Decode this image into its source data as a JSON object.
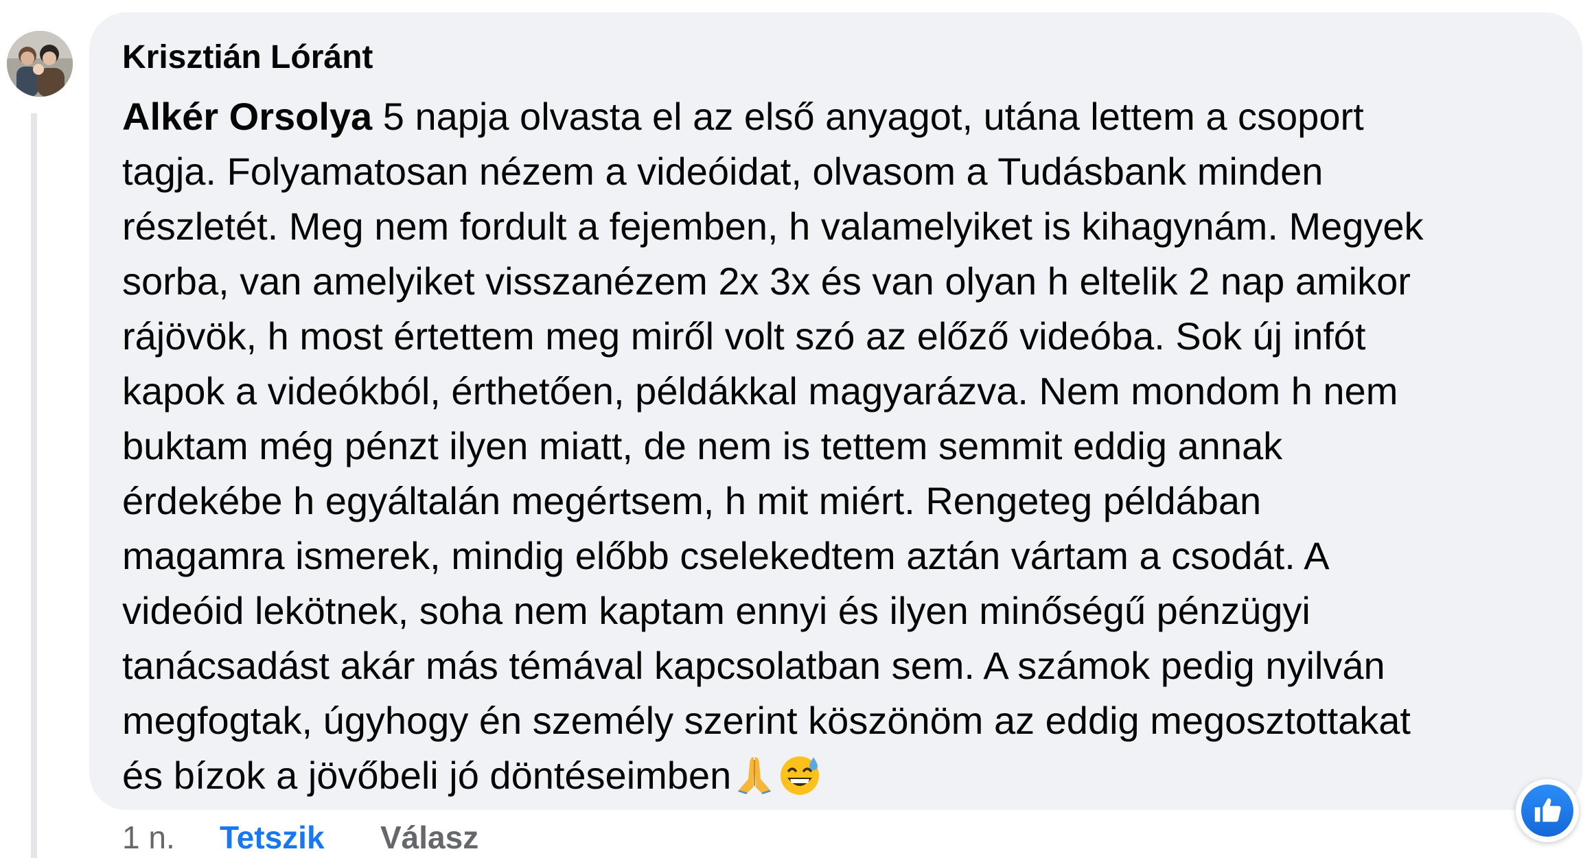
{
  "comment": {
    "author_name": "Krisztián Lóránt",
    "mention": "Alkér Orsolya",
    "lines": [
      " 5 napja olvasta el az első anyagot, utána lettem a csoport",
      "tagja. Folyamatosan nézem a videóidat, olvasom a Tudásbank minden",
      "részletét. Meg nem fordult a fejemben, h valamelyiket is kihagynám. Megyek",
      "sorba, van amelyiket visszanézem 2x 3x és van olyan h eltelik 2 nap amikor",
      "rájövök, h most értettem meg miről volt szó az előző videóba. Sok új infót",
      "kapok a videókból, érthetően, példákkal magyarázva. Nem mondom h nem",
      "buktam még pénzt ilyen miatt, de nem is tettem semmit eddig annak",
      "érdekébe h egyáltalán megértsem, h mit miért. Rengeteg példában",
      "magamra ismerek, mindig előbb cselekedtem aztán vártam a csodát. A",
      "videóid lekötnek, soha nem kaptam ennyi és ilyen minőségű pénzügyi",
      "tanácsadást akár más témával kapcsolatban sem. A számok pedig nyilván",
      "megfogtak, úgyhogy én személy szerint köszönöm az eddig megosztottakat",
      "és bízok a jövőbeli jó döntéseimben"
    ],
    "emojis": [
      "folded-hands-emoji",
      "grinning-sweat-emoji"
    ],
    "reaction_icon": "thumbs-up-icon"
  },
  "actions": {
    "timestamp": "1 n.",
    "like_label": "Tetszik",
    "reply_label": "Válasz"
  },
  "colors": {
    "bubble_background": "#f0f2f5",
    "text": "#050505",
    "secondary_text": "#65676b",
    "accent_blue": "#1877f2",
    "thread_line": "#e4e6eb"
  }
}
